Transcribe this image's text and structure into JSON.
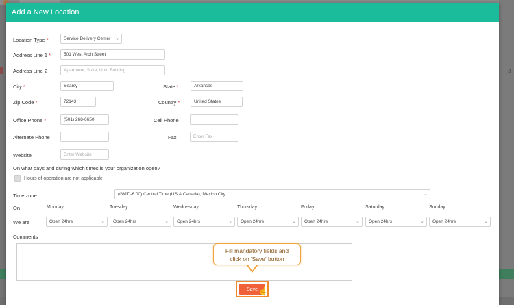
{
  "modal": {
    "title": "Add a New Location"
  },
  "form": {
    "location_type": {
      "label": "Location Type",
      "value": "Service Delivery Center"
    },
    "address_line_1": {
      "label": "Address Line 1",
      "value": "501 West Arch Street"
    },
    "address_line_2": {
      "label": "Address Line 2",
      "placeholder": "Apartment, Suite, Unit, Building"
    },
    "city": {
      "label": "City",
      "value": "Searcy"
    },
    "state": {
      "label": "State",
      "value": "Arkansas"
    },
    "zip_code": {
      "label": "Zip Code",
      "value": "72143"
    },
    "country": {
      "label": "Country",
      "value": "United States"
    },
    "office_phone": {
      "label": "Office Phone",
      "value": "(501) 268-6650"
    },
    "cell_phone": {
      "label": "Cell Phone",
      "value": ""
    },
    "alternate_phone": {
      "label": "Alternate Phone",
      "value": ""
    },
    "fax": {
      "label": "Fax",
      "placeholder": "Enter Fax"
    },
    "website": {
      "label": "Website",
      "placeholder": "Enter Website"
    }
  },
  "hours": {
    "question": "On what days and during which times is your organization open?",
    "not_applicable_label": "Hours of operation are not applicable",
    "timezone_label": "Time zone",
    "timezone_value": "(GMT -6:00) Central Time (US & Canada), Mexico City",
    "on_label": "On",
    "we_are_label": "We are",
    "days": [
      {
        "name": "Monday",
        "value": "Open 24hrs"
      },
      {
        "name": "Tuesday",
        "value": "Open 24hrs"
      },
      {
        "name": "Wednesday",
        "value": "Open 24hrs"
      },
      {
        "name": "Thursday",
        "value": "Open 24hrs"
      },
      {
        "name": "Friday",
        "value": "Open 24hrs"
      },
      {
        "name": "Saturday",
        "value": "Open 24hrs"
      },
      {
        "name": "Sunday",
        "value": "Open 24hrs"
      }
    ]
  },
  "comments": {
    "label": "Comments"
  },
  "callout": {
    "line1": "Fill mandatory fields and",
    "line2": "click on 'Save' button"
  },
  "actions": {
    "save_label": "Save"
  },
  "background": {
    "right_number": "4"
  },
  "colors": {
    "header": "#1bbc9b",
    "required": "#e03b3b",
    "save_button": "#f0613a",
    "highlight": "#f08a2a"
  },
  "icons": {
    "select_caret": "chevron-down-icon",
    "cursor": "hand-pointer-icon"
  }
}
